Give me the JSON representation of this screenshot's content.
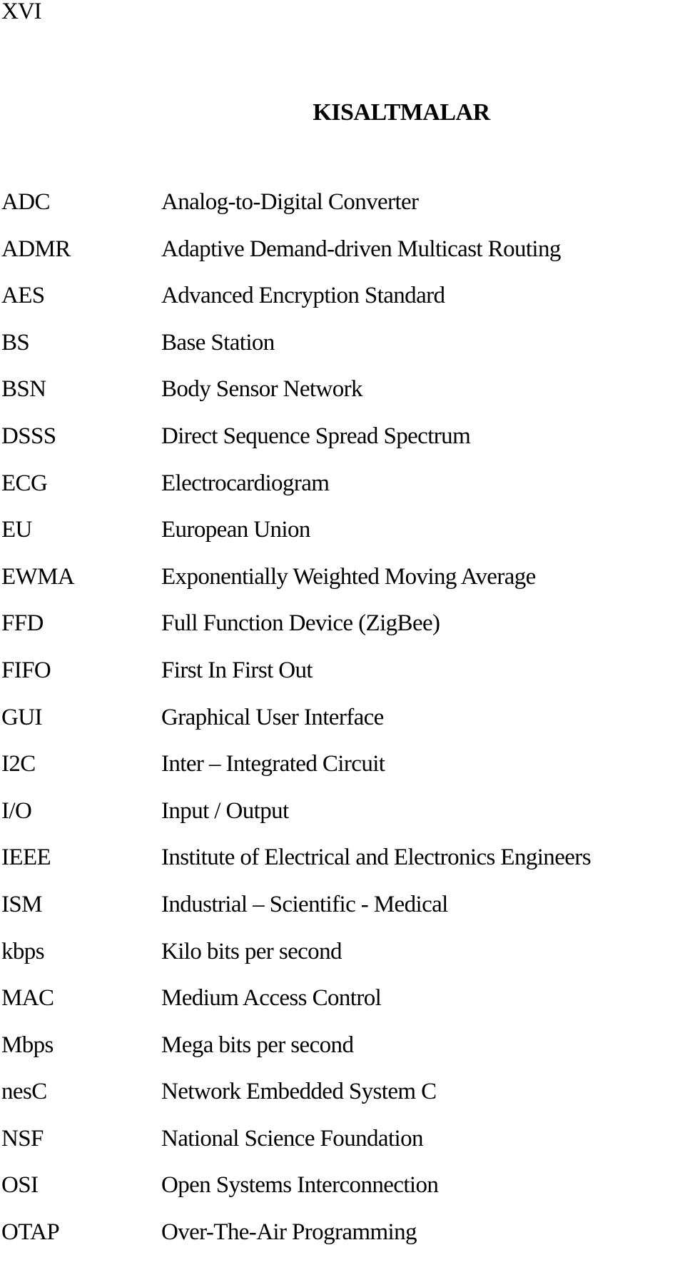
{
  "page": {
    "number": "XVI",
    "title": "KISALTMALAR"
  },
  "abbreviations": [
    {
      "term": "ADC",
      "definition": "Analog-to-Digital Converter"
    },
    {
      "term": "ADMR",
      "definition": "Adaptive Demand-driven Multicast Routing"
    },
    {
      "term": "AES",
      "definition": "Advanced Encryption Standard"
    },
    {
      "term": "BS",
      "definition": "Base Station"
    },
    {
      "term": "BSN",
      "definition": "Body Sensor Network"
    },
    {
      "term": "DSSS",
      "definition": "Direct Sequence Spread Spectrum"
    },
    {
      "term": "ECG",
      "definition": "Electrocardiogram"
    },
    {
      "term": "EU",
      "definition": "European Union"
    },
    {
      "term": "EWMA",
      "definition": "Exponentially Weighted Moving Average"
    },
    {
      "term": "FFD",
      "definition": "Full Function Device (ZigBee)"
    },
    {
      "term": "FIFO",
      "definition": "First In First Out"
    },
    {
      "term": "GUI",
      "definition": "Graphical User Interface"
    },
    {
      "term": "I2C",
      "definition": "Inter – Integrated Circuit"
    },
    {
      "term": "I/O",
      "definition": "Input / Output"
    },
    {
      "term": "IEEE",
      "definition": "Institute of Electrical and Electronics Engineers"
    },
    {
      "term": "ISM",
      "definition": "Industrial – Scientific - Medical"
    },
    {
      "term": "kbps",
      "definition": "Kilo bits per second"
    },
    {
      "term": "MAC",
      "definition": "Medium Access Control"
    },
    {
      "term": "Mbps",
      "definition": "Mega bits per second"
    },
    {
      "term": "nesC",
      "definition": "Network Embedded System C"
    },
    {
      "term": "NSF",
      "definition": "National Science Foundation"
    },
    {
      "term": "OSI",
      "definition": "Open Systems Interconnection"
    },
    {
      "term": "OTAP",
      "definition": "Over-The-Air Programming"
    }
  ]
}
